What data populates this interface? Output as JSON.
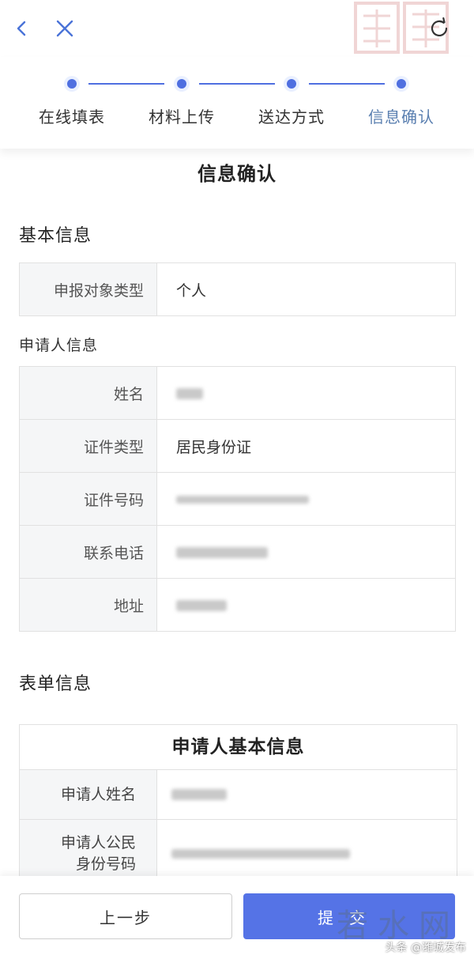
{
  "steps": [
    {
      "label": "在线填表",
      "active": false
    },
    {
      "label": "材料上传",
      "active": false
    },
    {
      "label": "送达方式",
      "active": false
    },
    {
      "label": "信息确认",
      "active": true
    }
  ],
  "page": {
    "title": "信息确认"
  },
  "basic_info": {
    "title": "基本信息",
    "rows": [
      {
        "key": "申报对象类型",
        "value": "个人"
      }
    ]
  },
  "applicant_info": {
    "title": "申请人信息",
    "rows": [
      {
        "key": "姓名",
        "value": ""
      },
      {
        "key": "证件类型",
        "value": "居民身份证"
      },
      {
        "key": "证件号码",
        "value": ""
      },
      {
        "key": "联系电话",
        "value": ""
      },
      {
        "key": "地址",
        "value": ""
      }
    ]
  },
  "form_info": {
    "title": "表单信息",
    "block_title": "申请人基本信息",
    "rows": [
      {
        "key": "申请人姓名",
        "value": ""
      },
      {
        "key_line1": "申请人公民",
        "key_line2": "身份号码",
        "value": ""
      }
    ]
  },
  "buttons": {
    "prev": "上一步",
    "submit": "提交"
  },
  "watermark": {
    "text": "若水网",
    "credit": "头条 @潍城发布"
  },
  "colors": {
    "accent": "#4f6fe0",
    "active_step": "#5a7fb0",
    "submit_bg": "#5573e6"
  }
}
